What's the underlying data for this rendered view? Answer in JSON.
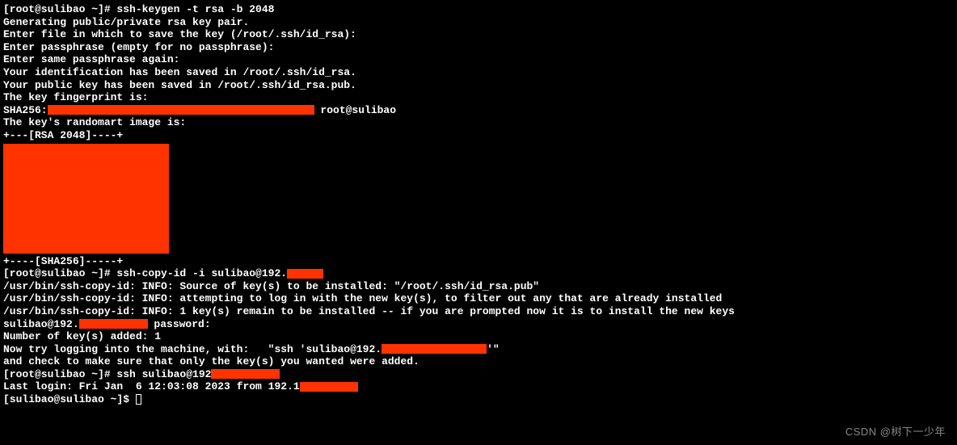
{
  "lines": {
    "l01": "[root@sulibao ~]# ssh-keygen -t rsa -b 2048",
    "l02": "Generating public/private rsa key pair.",
    "l03": "Enter file in which to save the key (/root/.ssh/id_rsa):",
    "l04": "Enter passphrase (empty for no passphrase):",
    "l05": "Enter same passphrase again:",
    "l06": "Your identification has been saved in /root/.ssh/id_rsa.",
    "l07": "Your public key has been saved in /root/.ssh/id_rsa.pub.",
    "l08": "The key fingerprint is:",
    "l09a": "SHA256:",
    "l09b": " root@sulibao",
    "l10": "The key's randomart image is:",
    "l11": "+---[RSA 2048]----+",
    "l12": "+----[SHA256]-----+",
    "l13a": "[root@sulibao ~]# ssh-copy-id -i sulibao@192.",
    "l14": "/usr/bin/ssh-copy-id: INFO: Source of key(s) to be installed: \"/root/.ssh/id_rsa.pub\"",
    "l15": "/usr/bin/ssh-copy-id: INFO: attempting to log in with the new key(s), to filter out any that are already installed",
    "l16": "/usr/bin/ssh-copy-id: INFO: 1 key(s) remain to be installed -- if you are prompted now it is to install the new keys",
    "l17a": "sulibao@192.",
    "l17b": " password:",
    "l18": "",
    "l19": "Number of key(s) added: 1",
    "l20": "",
    "l21a": "Now try logging into the machine, with:   \"ssh 'sulibao@192.",
    "l21b": "'\"",
    "l22": "and check to make sure that only the key(s) you wanted were added.",
    "l23": "",
    "l24a": "[root@sulibao ~]# ssh sulibao@192",
    "l25a": "Last login: Fri Jan  6 12:03:08 2023 from 192.1",
    "l26a": "[sulibao@sulibao ~]$ "
  },
  "watermark": "CSDN @树下一少年"
}
